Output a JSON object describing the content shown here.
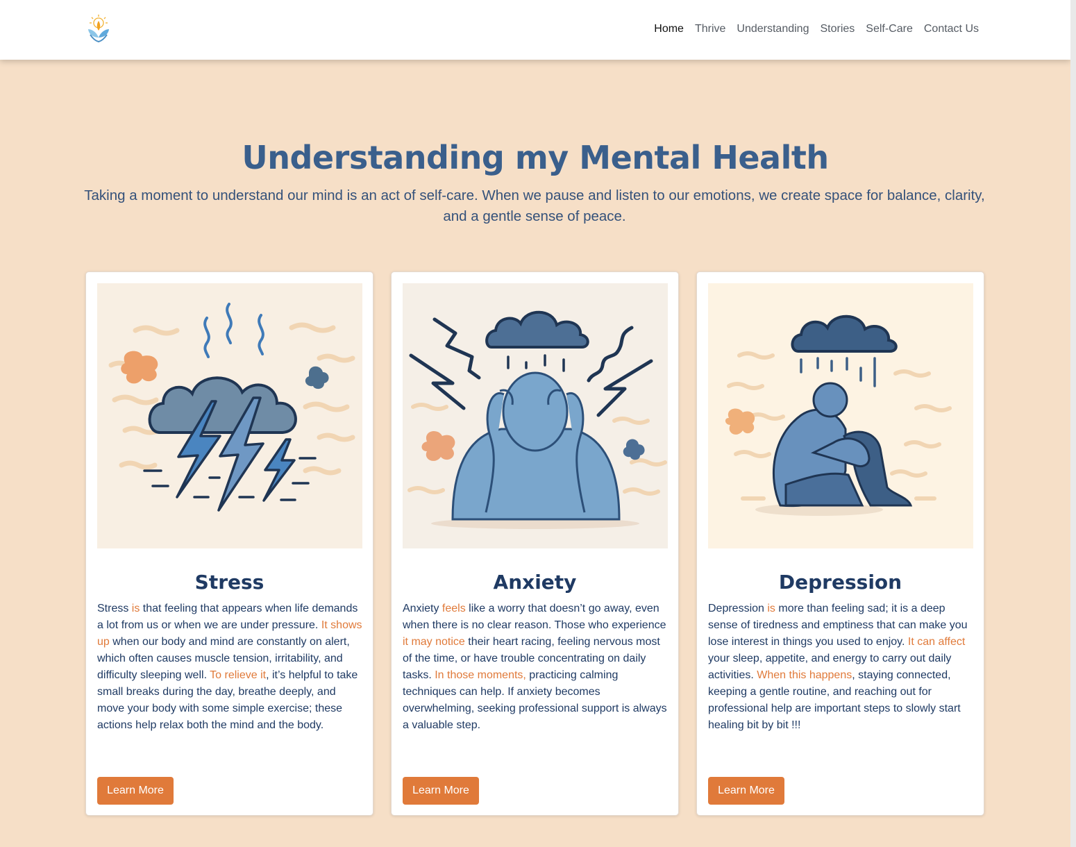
{
  "nav": {
    "items": [
      {
        "label": "Home",
        "active": true
      },
      {
        "label": "Thrive"
      },
      {
        "label": "Understanding"
      },
      {
        "label": "Stories"
      },
      {
        "label": "Self-Care"
      },
      {
        "label": "Contact Us"
      }
    ]
  },
  "hero": {
    "title": "Understanding my Mental Health",
    "intro": "Taking a moment to understand our mind is an act of self-care. When we pause and listen to our emotions, we create space for balance, clarity, and a gentle sense of peace."
  },
  "cards": [
    {
      "title": "Stress",
      "image_icon": "storm-cloud-icon",
      "segments": [
        {
          "t": "Stress "
        },
        {
          "t": "is",
          "hl": true
        },
        {
          "t": " that feeling that appears when life demands a lot from us or when we are under pressure. "
        },
        {
          "t": "It shows up",
          "hl": true
        },
        {
          "t": " when our body and mind are constantly on alert, which often causes muscle tension, irritability, and difficulty sleeping well. "
        },
        {
          "t": "To relieve it",
          "hl": true
        },
        {
          "t": ", it’s helpful to take small breaks during the day, breathe deeply, and move your body with some simple exercise; these actions help relax both the mind and the body."
        }
      ],
      "button": "Learn More"
    },
    {
      "title": "Anxiety",
      "image_icon": "anxious-person-icon",
      "segments": [
        {
          "t": "Anxiety "
        },
        {
          "t": "feels",
          "hl": true
        },
        {
          "t": " like a worry that doesn’t go away, even when there is no clear reason. Those who experience "
        },
        {
          "t": "it may notice",
          "hl": true
        },
        {
          "t": " their heart racing, feeling nervous most of the time, or have trouble concentrating on daily tasks. "
        },
        {
          "t": "In those moments,",
          "hl": true
        },
        {
          "t": " practicing calming techniques can help. If anxiety becomes overwhelming, seeking professional support is always a valuable step."
        }
      ],
      "button": "Learn More"
    },
    {
      "title": "Depression",
      "image_icon": "sad-person-icon",
      "segments": [
        {
          "t": "Depression "
        },
        {
          "t": "is",
          "hl": true
        },
        {
          "t": " more than feeling sad; it is a deep sense of tiredness and emptiness that can make you lose interest in things you used to enjoy. "
        },
        {
          "t": "It can affect",
          "hl": true
        },
        {
          "t": " your sleep, appetite, and energy to carry out daily activities. "
        },
        {
          "t": "When this happens",
          "hl": true
        },
        {
          "t": ", staying connected, keeping a gentle routine, and reaching out for professional help are important steps to slowly start healing bit by bit !!!"
        }
      ],
      "button": "Learn More"
    }
  ],
  "colors": {
    "background": "#f6dfc7",
    "accent": "#e07a3a",
    "heading": "#3a5f8c",
    "text": "#1f3a63"
  }
}
